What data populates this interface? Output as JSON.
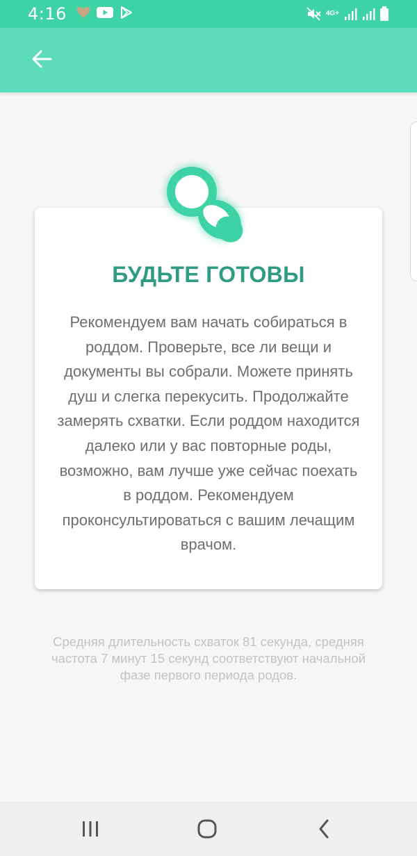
{
  "status_bar": {
    "time": "4:16",
    "network_label": "4G+",
    "icons": [
      "heart-icon",
      "youtube-icon",
      "play-store-icon",
      "mute-icon",
      "signal-icon",
      "signal-icon",
      "battery-icon"
    ]
  },
  "app_bar": {
    "back_icon": "arrow-left-icon"
  },
  "card": {
    "badge_icon": "pacifier-icon",
    "title": "БУДЬТЕ ГОТОВЫ",
    "body": "Рекомендуем вам начать собираться в роддом. Проверьте, все ли вещи и документы вы собрали. Можете принять душ и слегка перекусить. Продолжайте замерять схватки. Если роддом находится далеко или у вас повторные роды, возможно, вам лучше уже сейчас поехать в роддом. Рекомендуем проконсультироваться с вашим лечащим врачом."
  },
  "summary": "Средняя длительность схваток 81 секунда, средняя частота 7 минут 15 секунд соответствуют начальной фазе первого периода родов.",
  "nav_bar": {
    "recents_icon": "recent-apps-icon",
    "home_icon": "home-icon",
    "back_icon": "back-icon"
  },
  "colors": {
    "status_bar": "#3ed3a5",
    "app_bar": "#5ddcb9",
    "title": "#2f9b80",
    "badge": "#3ed3a5"
  }
}
